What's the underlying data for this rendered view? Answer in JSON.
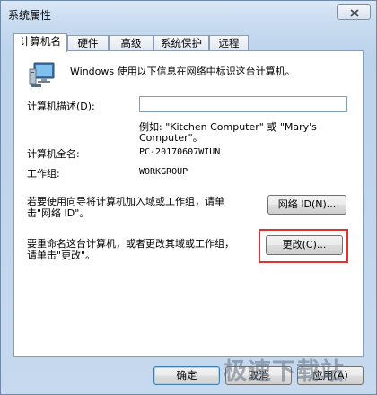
{
  "window": {
    "title": "系统属性"
  },
  "tabs": [
    "计算机名",
    "硬件",
    "高级",
    "系统保护",
    "远程"
  ],
  "intro": "Windows 使用以下信息在网络中标识这台计算机。",
  "description": {
    "label": "计算机描述(D):",
    "value": "",
    "example_line1": "例如: \"Kitchen Computer\" 或 \"Mary's",
    "example_line2": "Computer\"。"
  },
  "full_name": {
    "label": "计算机全名:",
    "value": "PC-20170607WIUN"
  },
  "workgroup": {
    "label": "工作组:",
    "value": "WORKGROUP"
  },
  "network_id": {
    "text_line1": "若要使用向导将计算机加入域或工作组，请单",
    "text_line2": "击\"网络 ID\"。",
    "button": "网络 ID(N)..."
  },
  "change": {
    "text_line1": "要重命名这台计算机，或者更改其域或工作组，",
    "text_line2": "请单击\"更改\"。",
    "button": "更改(C)..."
  },
  "buttons": {
    "ok": "确定",
    "cancel": "取消",
    "apply": "应用(A)"
  },
  "watermark": "极速下载站",
  "colors": {
    "highlight": "#e0322d"
  }
}
